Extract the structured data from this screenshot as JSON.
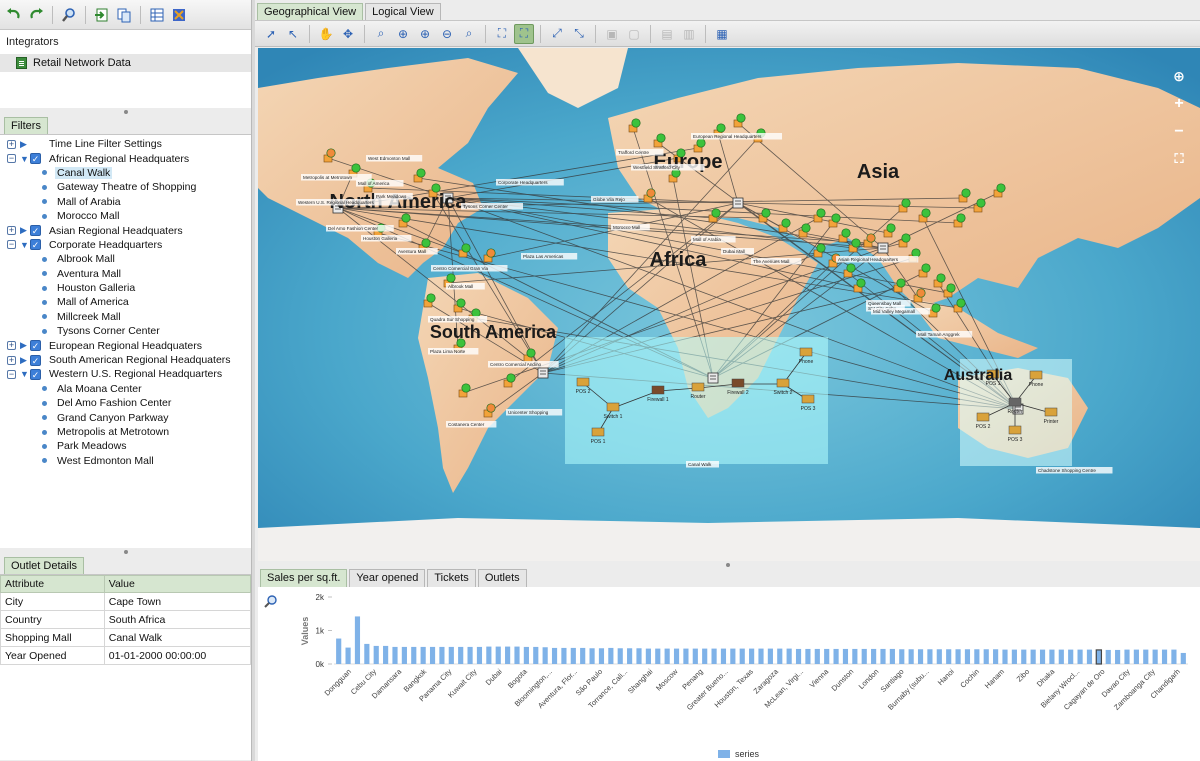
{
  "left_toolbar": {
    "icons": [
      "undo-icon",
      "redo-icon",
      "search-icon",
      "import-icon",
      "export-icon",
      "table-icon",
      "settings-icon"
    ]
  },
  "integrators": {
    "title": "Integrators",
    "items": [
      {
        "label": "Retail Network Data",
        "icon": "document-icon"
      }
    ]
  },
  "filters": {
    "tab_label": "Filters",
    "tree": [
      {
        "type": "group",
        "label": "Time Line Filter Settings",
        "expanded": false,
        "checkbox": false
      },
      {
        "type": "group",
        "label": "African Regional Headquaters",
        "expanded": true,
        "checkbox": true
      },
      {
        "type": "leaf",
        "label": "Canal Walk",
        "selected": true
      },
      {
        "type": "leaf",
        "label": "Gateway Theatre of Shopping"
      },
      {
        "type": "leaf",
        "label": "Mall of Arabia"
      },
      {
        "type": "leaf",
        "label": "Morocco Mall"
      },
      {
        "type": "group",
        "label": "Asian Regional Headquaters",
        "expanded": false,
        "checkbox": true
      },
      {
        "type": "group",
        "label": "Corporate Headquarters",
        "expanded": true,
        "checkbox": true
      },
      {
        "type": "leaf",
        "label": "Albrook Mall"
      },
      {
        "type": "leaf",
        "label": "Aventura Mall"
      },
      {
        "type": "leaf",
        "label": "Houston Galleria"
      },
      {
        "type": "leaf",
        "label": "Mall of America"
      },
      {
        "type": "leaf",
        "label": "Millcreek Mall"
      },
      {
        "type": "leaf",
        "label": "Tysons Corner Center"
      },
      {
        "type": "group",
        "label": "European Regional Headquaters",
        "expanded": false,
        "checkbox": true
      },
      {
        "type": "group",
        "label": "South American Regional Headquaters",
        "expanded": false,
        "checkbox": true
      },
      {
        "type": "group",
        "label": "Western U.S. Regional Headquarters",
        "expanded": true,
        "checkbox": true
      },
      {
        "type": "leaf",
        "label": "Ala Moana Center"
      },
      {
        "type": "leaf",
        "label": "Del Amo Fashion Center"
      },
      {
        "type": "leaf",
        "label": "Grand Canyon Parkway"
      },
      {
        "type": "leaf",
        "label": "Metropolis at Metrotown"
      },
      {
        "type": "leaf",
        "label": "Park Meadows"
      },
      {
        "type": "leaf",
        "label": "West Edmonton Mall"
      }
    ]
  },
  "outlet_details": {
    "tab_label": "Outlet Details",
    "headers": [
      "Attribute",
      "Value"
    ],
    "rows": [
      [
        "City",
        "Cape Town"
      ],
      [
        "Country",
        "South Africa"
      ],
      [
        "Shopping Mall",
        "Canal Walk"
      ],
      [
        "Year Opened",
        "01-01-2000 00:00:00"
      ]
    ]
  },
  "main_tabs": [
    "Geographical View",
    "Logical View"
  ],
  "active_main_tab": 0,
  "map_toolbar": {
    "icons": [
      "select-icon",
      "pointer-icon",
      "pan-hand-icon",
      "move-icon",
      "zoom-fit-icon",
      "zoom-in-icon",
      "zoom-in-alt-icon",
      "zoom-out-icon",
      "zoom-region-icon",
      "layout-icon",
      "layout-active-icon",
      "expand-icon",
      "collapse-icon",
      "group-icon",
      "ungroup-icon",
      "lock-icon",
      "unlock-icon",
      "export-image-icon"
    ],
    "active": [
      10
    ],
    "disabled": [
      13,
      14,
      15,
      16
    ]
  },
  "map": {
    "continents": [
      "North America",
      "Europe",
      "Asia",
      "Africa",
      "South America",
      "Australia"
    ],
    "places": [
      "Canal Walk",
      "Metropolis at Metrotown",
      "West Edmonton Mall",
      "Mall of America",
      "Park Meadows",
      "Corporate Headquarters",
      "Tysons Corner Center",
      "Western U.S. Regional Headquarters",
      "Del Amo Fashion Center",
      "Houston Galleria",
      "Aventura Mall",
      "Plaza Las Americas",
      "Centro Comercial Gran Via",
      "Albrook Mall",
      "Quadra Sur Shopping",
      "Plaza Lima Norte",
      "Centro Comercial Andino",
      "Unicenter Shopping",
      "Costanera Center",
      "European Regional Headquarters",
      "Trafford Centre",
      "Westfield Stratford City",
      "Globe Vila Rejo",
      "Morocco Mall",
      "Mall of Arabia",
      "Dubai Mall",
      "The Avenues Mall",
      "Asian Regional Headquarters",
      "SM City Cebu",
      "Chadstone Shopping Centre",
      "Mall Taman Anggrek",
      "Mid Valley Megamall",
      "Queensbay Mall"
    ],
    "network_left": {
      "nodes": [
        "POS 2",
        "Switch 1",
        "Firewall 1",
        "Router",
        "Firewall 2",
        "Switch 2",
        "Phone",
        "POS 3",
        "POS 1"
      ]
    },
    "network_right": {
      "nodes": [
        "POS 1",
        "Phone",
        "Router",
        "POS 2",
        "POS 3",
        "Printer"
      ]
    },
    "colors": {
      "ocean": "#5fb3cf",
      "land": "#f0c8a0",
      "node_green": "#3cc23c",
      "selection": "#b4ffff"
    }
  },
  "chart_tabs": [
    "Sales per sq.ft.",
    "Year opened",
    "Tickets",
    "Outlets"
  ],
  "active_chart_tab": 0,
  "chart_data": {
    "type": "bar",
    "title": "",
    "xlabel": "",
    "ylabel": "Values",
    "ylim": [
      0,
      2000
    ],
    "yticks": [
      "2k",
      "1k",
      "0k"
    ],
    "tick_labels": [
      "Dongguan",
      "Cebu City",
      "Damansara",
      "Bangkok",
      "Panama City",
      "Kuwait City",
      "Dubai",
      "Bogota",
      "Bloomington,...",
      "Aventura, Flor...",
      "São Paulo",
      "Torrance, Cali...",
      "Shanghai",
      "Moscow",
      "Penang",
      "Greater Bueno...",
      "Houston, Texas",
      "Zaragoza",
      "McLean, Virgi...",
      "Vienna",
      "Dunston",
      "London",
      "Santiago",
      "Burnaby (subu...",
      "Hanoi",
      "Cochin",
      "Hanam",
      "Zibo",
      "Dhaka",
      "Bielany Wrocl...",
      "Cagayan de Oro",
      "Davao City",
      "Zamboanga City",
      "Chandigarh"
    ],
    "values": [
      760,
      490,
      1420,
      600,
      540,
      540,
      510,
      510,
      510,
      510,
      510,
      510,
      510,
      510,
      510,
      510,
      520,
      520,
      520,
      520,
      510,
      510,
      500,
      480,
      480,
      480,
      480,
      470,
      470,
      480,
      470,
      470,
      470,
      460,
      460,
      460,
      460,
      460,
      460,
      460,
      460,
      460,
      460,
      460,
      460,
      460,
      460,
      460,
      460,
      450,
      450,
      450,
      450,
      450,
      450,
      450,
      450,
      450,
      450,
      450,
      440,
      440,
      440,
      440,
      440,
      440,
      440,
      440,
      440,
      440,
      440,
      430,
      430,
      430,
      430,
      430,
      430,
      430,
      430,
      430,
      430,
      420,
      420,
      420,
      430,
      430,
      430,
      430,
      430,
      430,
      330
    ],
    "highlight_index": 81,
    "series": [
      {
        "name": "series"
      }
    ],
    "legend": "bottom-center",
    "colors": {
      "bar": "#7fb2e8",
      "highlight": "#444444"
    }
  }
}
